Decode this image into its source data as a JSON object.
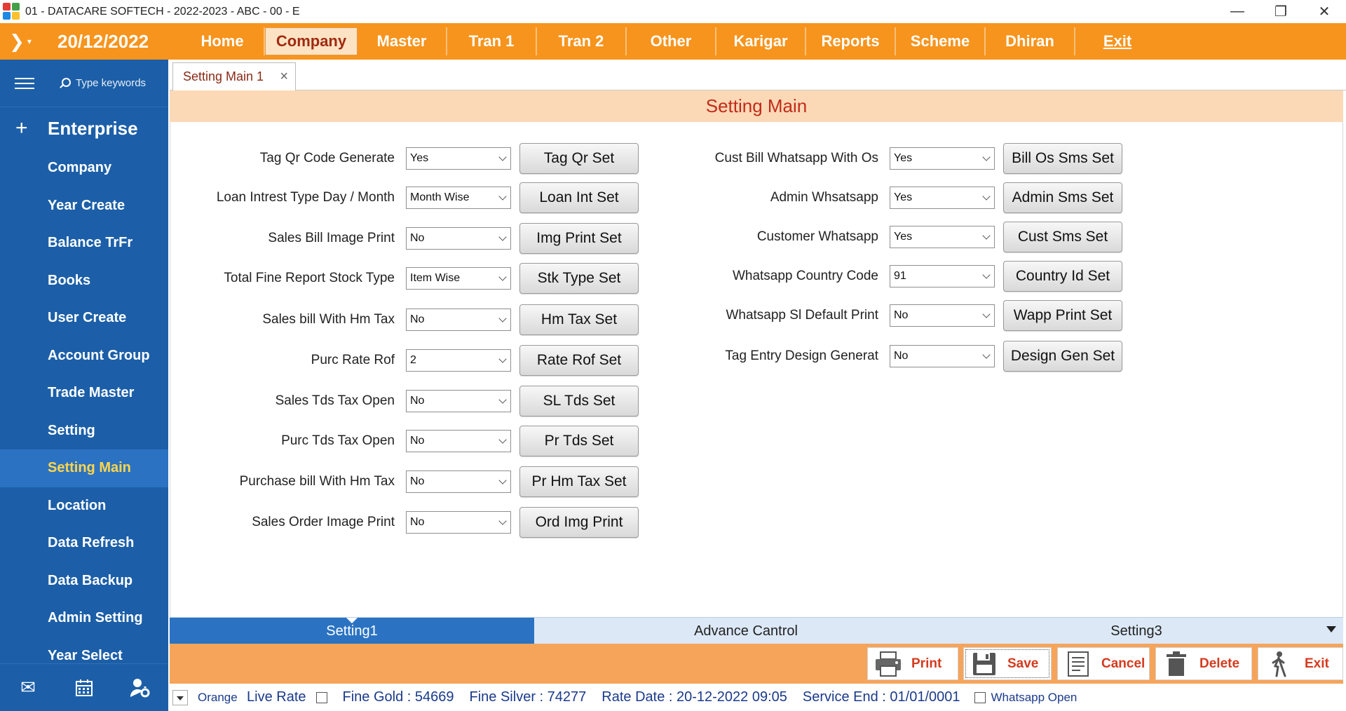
{
  "window": {
    "title": "01 - DATACARE SOFTECH - 2022-2023 - ABC - 00 - E"
  },
  "menubar": {
    "date": "20/12/2022",
    "items": [
      "Home",
      "Company",
      "Master",
      "Tran 1",
      "Tran 2",
      "Other",
      "Karigar",
      "Reports",
      "Scheme",
      "Dhiran",
      "Exit"
    ],
    "active": "Company"
  },
  "sidebar": {
    "search_placeholder": "Type keywords",
    "section": "Enterprise",
    "items": [
      "Company",
      "Year Create",
      "Balance TrFr",
      "Books",
      "User Create",
      "Account Group",
      "Trade Master",
      "Setting",
      "Setting Main",
      "Location",
      "Data Refresh",
      "Data Backup",
      "Admin Setting",
      "Year Select"
    ],
    "active": "Setting Main"
  },
  "tab": {
    "label": "Setting Main 1"
  },
  "panel": {
    "title": "Setting Main"
  },
  "left_fields": [
    {
      "label": "Tag Qr Code Generate",
      "value": "Yes",
      "button": "Tag Qr Set"
    },
    {
      "label": "Loan Intrest Type Day / Month",
      "value": "Month Wise",
      "button": "Loan Int Set"
    },
    {
      "label": "Sales Bill Image Print",
      "value": "No",
      "button": "Img Print Set"
    },
    {
      "label": "Total Fine Report Stock Type",
      "value": "Item Wise",
      "button": "Stk Type Set"
    },
    {
      "label": "Sales bill With Hm Tax",
      "value": "No",
      "button": "Hm Tax Set"
    },
    {
      "label": "Purc Rate Rof",
      "value": "2",
      "button": "Rate Rof Set"
    },
    {
      "label": "Sales Tds Tax Open",
      "value": "No",
      "button": "SL Tds Set"
    },
    {
      "label": "Purc Tds Tax Open",
      "value": "No",
      "button": "Pr Tds Set"
    },
    {
      "label": "Purchase bill With Hm Tax",
      "value": "No",
      "button": "Pr Hm Tax Set"
    },
    {
      "label": "Sales Order Image Print",
      "value": "No",
      "button": "Ord Img Print"
    }
  ],
  "right_fields": [
    {
      "label": "Cust Bill Whatsapp With Os",
      "value": "Yes",
      "button": "Bill Os Sms Set"
    },
    {
      "label": "Admin Whsatsapp",
      "value": "Yes",
      "button": "Admin Sms Set"
    },
    {
      "label": "Customer Whatsapp",
      "value": "Yes",
      "button": "Cust Sms Set"
    },
    {
      "label": "Whatsapp Country Code",
      "value": "91",
      "button": "Country Id Set"
    },
    {
      "label": "Whatsapp Sl Default Print",
      "value": "No",
      "button": "Wapp Print Set"
    },
    {
      "label": "Tag Entry Design Generat",
      "value": "No",
      "button": "Design Gen Set"
    }
  ],
  "bottom_tabs": [
    "Setting1",
    "Advance Cantrol",
    "Setting3"
  ],
  "actions": [
    "Print",
    "Save",
    "Cancel",
    "Delete",
    "Exit"
  ],
  "status": {
    "theme": "Orange",
    "live_rate": "Live Rate",
    "fine_gold": "Fine Gold : 54669",
    "fine_silver": "Fine Silver : 74277",
    "rate_date": "Rate Date : 20-12-2022 09:05",
    "service_end": "Service End :  01/01/0001",
    "whatsapp_open": "Whatsapp Open"
  },
  "colors": {
    "accent": "#f7941d",
    "sidebar": "#1c5fa8",
    "header_bg": "#fcd9b6",
    "title_red": "#c12b1b"
  }
}
